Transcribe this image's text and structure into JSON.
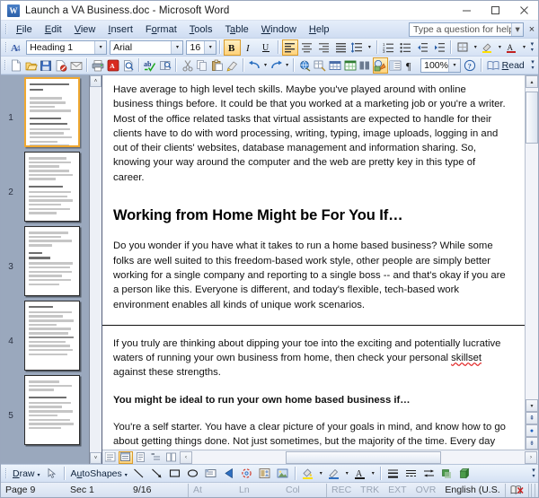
{
  "window": {
    "title": "Launch a VA Business.doc - Microsoft Word",
    "app_icon": "word-document-icon",
    "minimize_label": "Minimize",
    "maximize_label": "Maximize",
    "close_label": "Close"
  },
  "menubar": {
    "items": [
      {
        "label": "File",
        "mnemonic": "F"
      },
      {
        "label": "Edit",
        "mnemonic": "E"
      },
      {
        "label": "View",
        "mnemonic": "V"
      },
      {
        "label": "Insert",
        "mnemonic": "I"
      },
      {
        "label": "Format",
        "mnemonic": "o"
      },
      {
        "label": "Tools",
        "mnemonic": "T"
      },
      {
        "label": "Table",
        "mnemonic": "a"
      },
      {
        "label": "Window",
        "mnemonic": "W"
      },
      {
        "label": "Help",
        "mnemonic": "H"
      }
    ],
    "ask_a_question": {
      "placeholder": "Type a question for help",
      "value": ""
    },
    "close_window_label": "×"
  },
  "formatting_toolbar": {
    "styles_and_formatting_icon": "styles-formatting-icon",
    "style": {
      "value": "Heading 1",
      "label": "Style"
    },
    "font": {
      "value": "Arial",
      "label": "Font"
    },
    "size": {
      "value": "16",
      "label": "Font Size"
    },
    "bold": {
      "label": "Bold",
      "active": true
    },
    "italic": {
      "label": "Italic",
      "active": false
    },
    "underline": {
      "label": "Underline",
      "active": false
    },
    "align_left": {
      "label": "Align Left",
      "active": true
    },
    "align_center": {
      "label": "Center",
      "active": false
    },
    "align_right": {
      "label": "Align Right",
      "active": false
    },
    "justify": {
      "label": "Justify",
      "active": false
    },
    "line_spacing": {
      "label": "Line Spacing"
    },
    "numbering": {
      "label": "Numbering"
    },
    "bullets": {
      "label": "Bullets"
    },
    "decrease_indent": {
      "label": "Decrease Indent"
    },
    "increase_indent": {
      "label": "Increase Indent"
    },
    "borders": {
      "label": "Outside Border"
    },
    "highlight": {
      "label": "Highlight"
    },
    "font_color": {
      "label": "Font Color"
    }
  },
  "standard_toolbar": {
    "new": {
      "label": "New Blank Document"
    },
    "open": {
      "label": "Open"
    },
    "save": {
      "label": "Save"
    },
    "permission": {
      "label": "Permission"
    },
    "email": {
      "label": "E-mail"
    },
    "print": {
      "label": "Print"
    },
    "pdf": {
      "label": "Convert to Adobe PDF"
    },
    "print_preview": {
      "label": "Print Preview"
    },
    "spelling": {
      "label": "Spelling and Grammar"
    },
    "research": {
      "label": "Research"
    },
    "cut": {
      "label": "Cut"
    },
    "copy": {
      "label": "Copy"
    },
    "paste": {
      "label": "Paste"
    },
    "format_painter": {
      "label": "Format Painter"
    },
    "undo": {
      "label": "Undo"
    },
    "redo": {
      "label": "Redo"
    },
    "hyperlink": {
      "label": "Insert Hyperlink"
    },
    "tables_and_borders": {
      "label": "Tables and Borders"
    },
    "insert_table": {
      "label": "Insert Table"
    },
    "insert_excel": {
      "label": "Insert Microsoft Excel Worksheet"
    },
    "columns": {
      "label": "Columns"
    },
    "drawing": {
      "label": "Drawing",
      "active": true
    },
    "document_map": {
      "label": "Document Map"
    },
    "show_formatting": {
      "label": "Show/Hide ¶"
    },
    "zoom": {
      "value": "100%",
      "label": "Zoom"
    },
    "help": {
      "label": "Microsoft Office Word Help"
    },
    "read": {
      "label": "Read",
      "mnemonic": "R"
    }
  },
  "thumbnail_pane": {
    "pages": [
      {
        "number": "1",
        "selected": true
      },
      {
        "number": "2",
        "selected": false
      },
      {
        "number": "3",
        "selected": false
      },
      {
        "number": "4",
        "selected": false
      },
      {
        "number": "5",
        "selected": false
      }
    ],
    "scroll_up_label": "˄",
    "scroll_down_label": "˅"
  },
  "document": {
    "blocks": [
      {
        "type": "paragraph",
        "text": "Have average to high level tech skills. Maybe you've played around with online business things before. It could be that you worked at a marketing job or you're a writer. Most of the office related tasks that virtual assistants are expected to handle for their clients have to do with word processing, writing, typing, image uploads, logging in and out of their clients' websites, database management and information sharing. So, knowing your way around the computer and the web are pretty key in this type of career."
      },
      {
        "type": "heading",
        "text": "Working from Home Might be For You If…"
      },
      {
        "type": "paragraph",
        "text": "Do you wonder if you have what it takes to run a home based business? While some folks are well suited to this freedom-based work style, other people are simply better working for a single company and reporting to a single boss -- and that's okay if you are a person like this. Everyone is different, and today's flexible, tech-based work environment enables all kinds of unique work scenarios."
      },
      {
        "type": "page_break"
      },
      {
        "type": "paragraph_with_misspelling",
        "text_before": "If you truly are thinking about dipping your toe into the exciting and potentially lucrative waters of running your own business from home, then check your personal ",
        "misspelled": "skillset",
        "text_after": " against these strengths."
      },
      {
        "type": "bold_paragraph",
        "text": "You might be ideal to run your own home based business if…"
      },
      {
        "type": "paragraph",
        "text": "You're a self starter. You have a clear picture of your goals in mind, and know how to go about getting things done. Not just sometimes, but the majority of the time. Every day that you have your own home business will require you to accomplish great things in order to move another step closer to success."
      }
    ]
  },
  "view_bar": {
    "buttons": [
      {
        "name": "normal-view-button",
        "label": "Normal View",
        "active": false
      },
      {
        "name": "web-layout-view-button",
        "label": "Web Layout View",
        "active": true
      },
      {
        "name": "print-layout-view-button",
        "label": "Print Layout View",
        "active": false
      },
      {
        "name": "outline-view-button",
        "label": "Outline View",
        "active": false
      },
      {
        "name": "reading-layout-view-button",
        "label": "Reading Layout View",
        "active": false
      }
    ],
    "scroll_left_label": "‹",
    "scroll_right_label": "›"
  },
  "drawing_toolbar": {
    "draw_menu": {
      "label": "Draw",
      "mnemonic": "D"
    },
    "select_objects": {
      "label": "Select Objects"
    },
    "autoshapes_menu": {
      "label": "AutoShapes",
      "mnemonic": "u"
    },
    "line": {
      "label": "Line"
    },
    "arrow": {
      "label": "Arrow"
    },
    "rectangle": {
      "label": "Rectangle"
    },
    "oval": {
      "label": "Oval"
    },
    "text_box": {
      "label": "Text Box"
    },
    "wordart": {
      "label": "Insert WordArt"
    },
    "diagram": {
      "label": "Insert Diagram or Organization Chart"
    },
    "clip_art": {
      "label": "Insert Clip Art"
    },
    "picture": {
      "label": "Insert Picture"
    },
    "fill_color": {
      "label": "Fill Color"
    },
    "line_color": {
      "label": "Line Color"
    },
    "font_color": {
      "label": "Font Color"
    },
    "line_style": {
      "label": "Line Style"
    },
    "dash_style": {
      "label": "Dash Style"
    },
    "arrow_style": {
      "label": "Arrow Style"
    },
    "shadow_style": {
      "label": "Shadow Style"
    },
    "3d_style": {
      "label": "3-D Style"
    }
  },
  "statusbar": {
    "page": "Page 9",
    "section": "Sec 1",
    "page_of_total": "9/16",
    "at": "At",
    "line": "Ln",
    "column": "Col",
    "rec": "REC",
    "trk": "TRK",
    "ext": "EXT",
    "ovr": "OVR",
    "language": "English (U.S.",
    "spelling_status_icon": "spelling-and-grammar-status-icon"
  },
  "colors": {
    "accent": "#f0a830",
    "titlebar_bg": "#ffffff",
    "toolbar_bg": "#dce6f4",
    "thumbpane_bg": "#9aa8bd",
    "selection_border": "#f0a830",
    "misspelling_underline": "#e02020"
  }
}
